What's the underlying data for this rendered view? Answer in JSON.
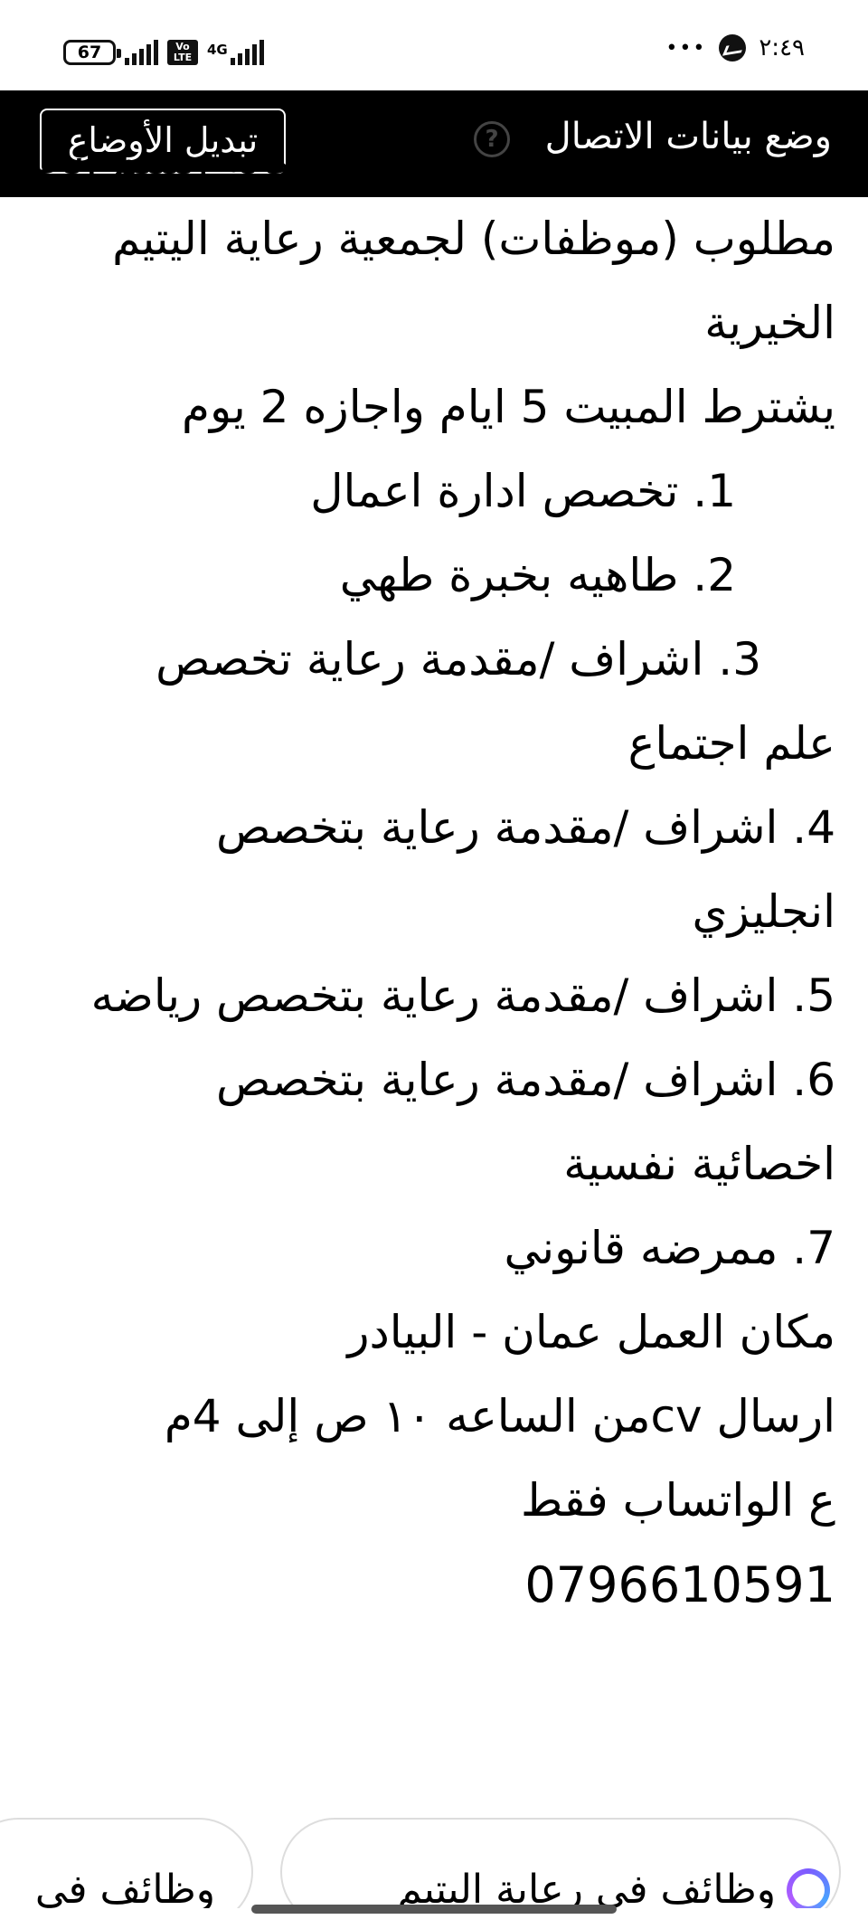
{
  "status_bar": {
    "battery_level": "67",
    "volte_label": "Vo LTE",
    "network_label": "4G",
    "time": "٢:٤٩",
    "more_dots": "•••",
    "icons": [
      "battery-icon",
      "signal-icon",
      "volte-icon",
      "signal-4g-icon",
      "messenger-icon"
    ]
  },
  "banner": {
    "title": "وضع بيانات الاتصال",
    "help_glyph": "?",
    "switch_button": "تبديل الأوضاع"
  },
  "article": {
    "cut_line": "مطلوب (موظفات) لجمعية رعاية اليتيم الخيرية",
    "lines": [
      "مطلوب (موظفات)  لجمعية رعاية اليتيم",
      "الخيرية",
      "يشترط المبيت 5 ايام واجازه 2 يوم",
      "1. تخصص ادارة اعمال",
      "2. طاهيه بخبرة طهي",
      "3. اشراف /مقدمة رعاية تخصص",
      "علم اجتماع",
      "4. اشراف /مقدمة رعاية بتخصص",
      "انجليزي",
      "5. اشراف /مقدمة رعاية بتخصص رياضه",
      "6. اشراف /مقدمة رعاية بتخصص",
      "اخصائية نفسية",
      "7.  ممرضه قانوني",
      "مكان العمل عمان - البيادر",
      "ارسال cvمن الساعه ١٠ ص إلى 4م",
      "ع الواتساب فقط",
      "0796610591"
    ]
  },
  "suggestions": [
    "وظائف في رعاية اليتيم",
    "وظائف في"
  ]
}
